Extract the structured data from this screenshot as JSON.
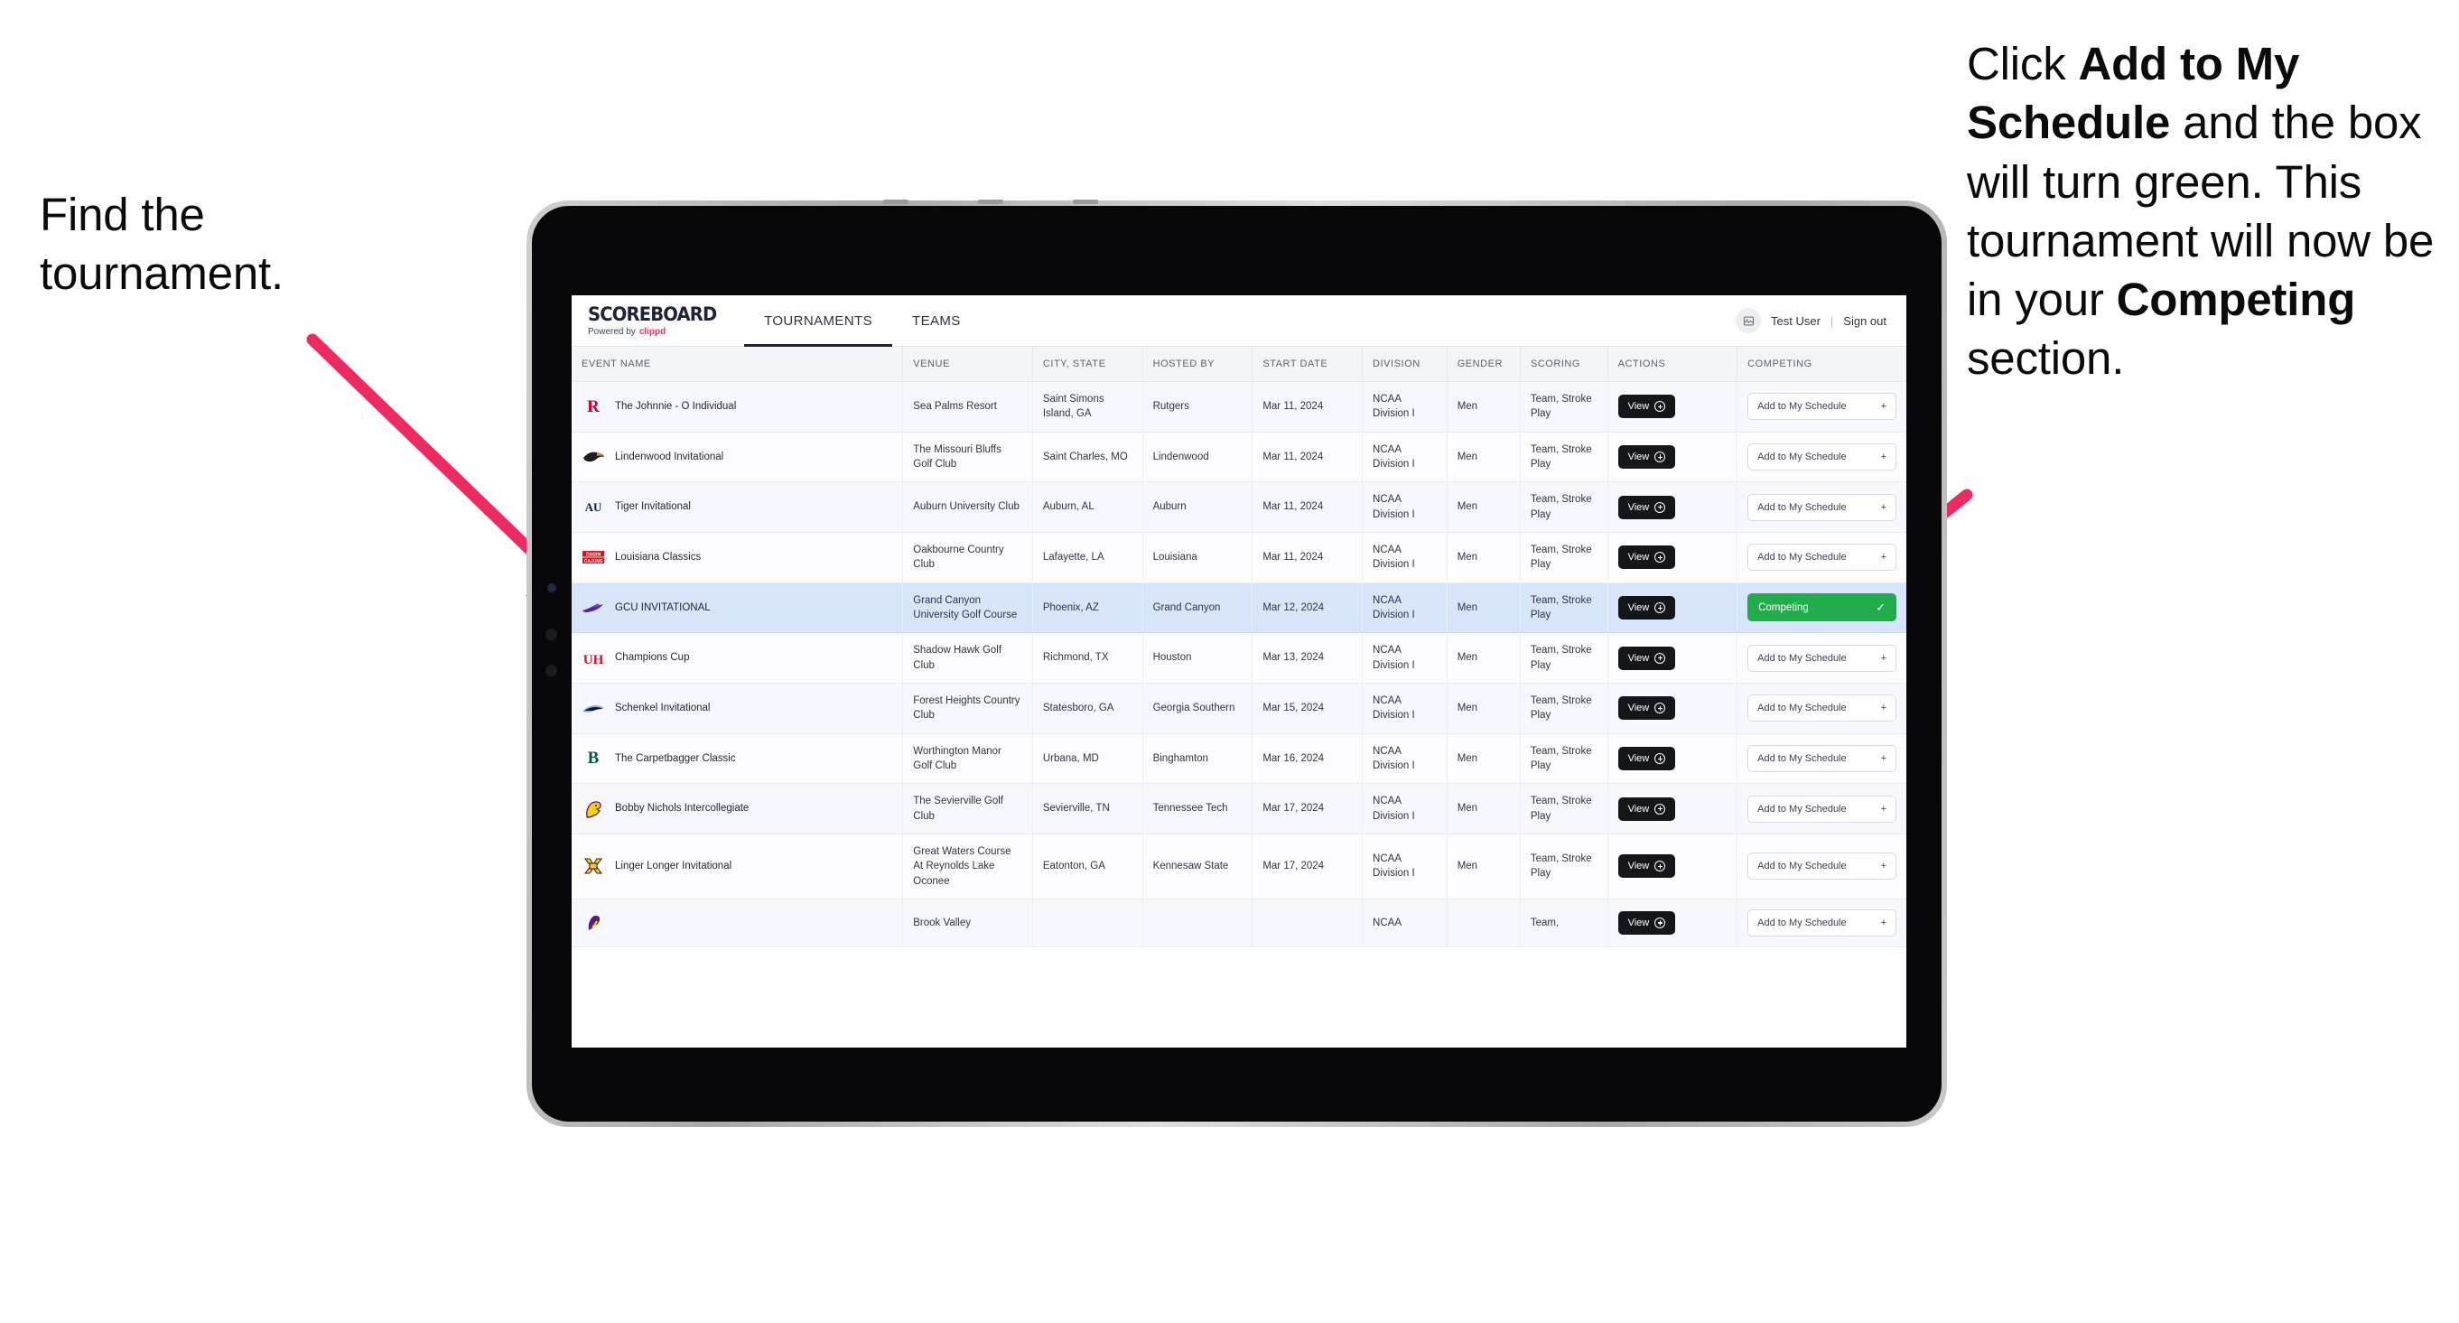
{
  "annotations": {
    "left": {
      "line1": "Find the",
      "line2": "tournament."
    },
    "right": {
      "seg1": "Click ",
      "bold1": "Add to My Schedule",
      "seg2": " and the box will turn green. This tournament will now be in your ",
      "bold2": "Competing",
      "seg3": " section."
    },
    "arrow_color": "#ee2a62"
  },
  "app": {
    "brand": {
      "title": "SCOREBOARD",
      "powered_prefix": "Powered by",
      "powered_brand": "clippd"
    },
    "tabs": [
      {
        "label": "TOURNAMENTS",
        "active": true
      },
      {
        "label": "TEAMS",
        "active": false
      }
    ],
    "user": {
      "avatar_icon": "user-image-icon",
      "name": "Test User",
      "separator": "|",
      "signout": "Sign out"
    }
  },
  "table": {
    "columns": [
      "EVENT NAME",
      "VENUE",
      "CITY, STATE",
      "HOSTED BY",
      "START DATE",
      "DIVISION",
      "GENDER",
      "SCORING",
      "ACTIONS",
      "COMPETING"
    ],
    "action_label": "View",
    "add_label": "Add to My Schedule",
    "add_icon": "+",
    "competing_label": "Competing",
    "competing_icon": "✓",
    "competing_color": "#21ad4b",
    "rows": [
      {
        "logo": "rutgers-logo",
        "event": "The Johnnie - O Individual",
        "venue": "Sea Palms Resort",
        "city": "Saint Simons Island, GA",
        "host": "Rutgers",
        "date": "Mar 11, 2024",
        "division": "NCAA Division I",
        "gender": "Men",
        "scoring": "Team, Stroke Play",
        "competing": false
      },
      {
        "logo": "lindenwood-logo",
        "event": "Lindenwood Invitational",
        "venue": "The Missouri Bluffs Golf Club",
        "city": "Saint Charles, MO",
        "host": "Lindenwood",
        "date": "Mar 11, 2024",
        "division": "NCAA Division I",
        "gender": "Men",
        "scoring": "Team, Stroke Play",
        "competing": false
      },
      {
        "logo": "auburn-logo",
        "event": "Tiger Invitational",
        "venue": "Auburn University Club",
        "city": "Auburn, AL",
        "host": "Auburn",
        "date": "Mar 11, 2024",
        "division": "NCAA Division I",
        "gender": "Men",
        "scoring": "Team, Stroke Play",
        "competing": false
      },
      {
        "logo": "louisiana-logo",
        "event": "Louisiana Classics",
        "venue": "Oakbourne Country Club",
        "city": "Lafayette, LA",
        "host": "Louisiana",
        "date": "Mar 11, 2024",
        "division": "NCAA Division I",
        "gender": "Men",
        "scoring": "Team, Stroke Play",
        "competing": false
      },
      {
        "logo": "grand-canyon-logo",
        "event": "GCU INVITATIONAL",
        "venue": "Grand Canyon University Golf Course",
        "city": "Phoenix, AZ",
        "host": "Grand Canyon",
        "date": "Mar 12, 2024",
        "division": "NCAA Division I",
        "gender": "Men",
        "scoring": "Team, Stroke Play",
        "competing": true,
        "selected": true
      },
      {
        "logo": "houston-logo",
        "event": "Champions Cup",
        "venue": "Shadow Hawk Golf Club",
        "city": "Richmond, TX",
        "host": "Houston",
        "date": "Mar 13, 2024",
        "division": "NCAA Division I",
        "gender": "Men",
        "scoring": "Team, Stroke Play",
        "competing": false
      },
      {
        "logo": "georgia-southern-logo",
        "event": "Schenkel Invitational",
        "venue": "Forest Heights Country Club",
        "city": "Statesboro, GA",
        "host": "Georgia Southern",
        "date": "Mar 15, 2024",
        "division": "NCAA Division I",
        "gender": "Men",
        "scoring": "Team, Stroke Play",
        "competing": false
      },
      {
        "logo": "binghamton-logo",
        "event": "The Carpetbagger Classic",
        "venue": "Worthington Manor Golf Club",
        "city": "Urbana, MD",
        "host": "Binghamton",
        "date": "Mar 16, 2024",
        "division": "NCAA Division I",
        "gender": "Men",
        "scoring": "Team, Stroke Play",
        "competing": false
      },
      {
        "logo": "tennessee-tech-logo",
        "event": "Bobby Nichols Intercollegiate",
        "venue": "The Sevierville Golf Club",
        "city": "Sevierville, TN",
        "host": "Tennessee Tech",
        "date": "Mar 17, 2024",
        "division": "NCAA Division I",
        "gender": "Men",
        "scoring": "Team, Stroke Play",
        "competing": false
      },
      {
        "logo": "kennesaw-state-logo",
        "event": "Linger Longer Invitational",
        "venue": "Great Waters Course At Reynolds Lake Oconee",
        "city": "Eatonton, GA",
        "host": "Kennesaw State",
        "date": "Mar 17, 2024",
        "division": "NCAA Division I",
        "gender": "Men",
        "scoring": "Team, Stroke Play",
        "competing": false
      },
      {
        "logo": "partial-logo",
        "event": "",
        "venue": "Brook Valley",
        "city": "",
        "host": "",
        "date": "",
        "division": "NCAA",
        "gender": "",
        "scoring": "Team,",
        "competing": false,
        "partial": true
      }
    ]
  }
}
